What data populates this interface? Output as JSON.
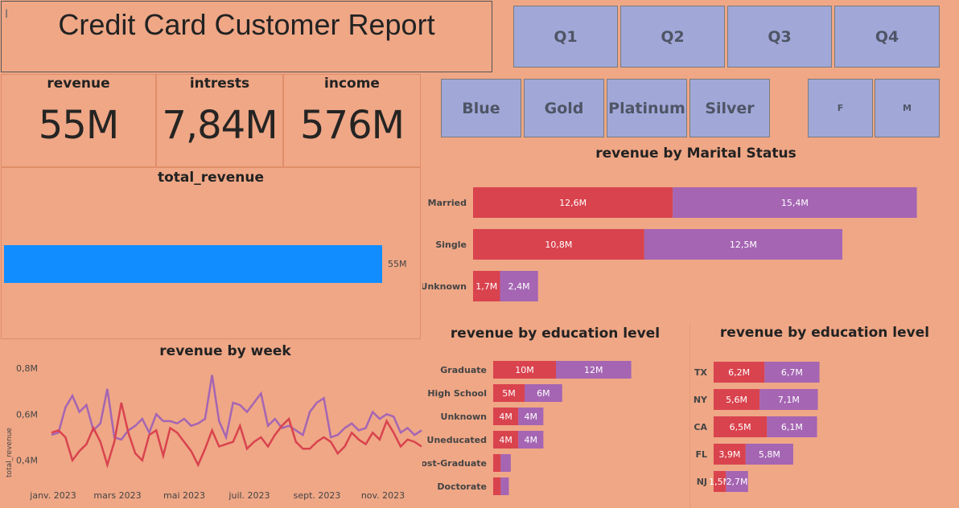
{
  "report": {
    "title": "Credit Card Customer Report",
    "cursor_glyph": "I"
  },
  "kpis": [
    {
      "label": "revenue",
      "value": "55M"
    },
    {
      "label": "intrests",
      "value": "7,84M"
    },
    {
      "label": "income",
      "value": "576M"
    }
  ],
  "quarter_slicer": [
    "Q1",
    "Q2",
    "Q3",
    "Q4"
  ],
  "card_slicer": [
    "Blue",
    "Gold",
    "Platinum",
    "Silver"
  ],
  "gender_slicer": [
    "F",
    "M"
  ],
  "colors": {
    "background": "#EFA786",
    "series_red": "#D9434E",
    "series_purple": "#A565B3",
    "total_bar": "#118DFF",
    "slicer": "#A1A8D8"
  },
  "chart_data": [
    {
      "type": "bar",
      "title": "total_revenue",
      "orientation": "horizontal",
      "values": [
        55
      ],
      "data_labels": [
        "55M"
      ],
      "unit": "M"
    },
    {
      "type": "line",
      "title": "revenue by week",
      "ylabel": "total_revenue",
      "ylim": [
        0.35,
        0.8
      ],
      "yticks": [
        "0,8M",
        "0,6M",
        "0,4M"
      ],
      "ytick_values": [
        0.8,
        0.6,
        0.4
      ],
      "xticks": [
        "janv. 2023",
        "mars 2023",
        "mai 2023",
        "juil. 2023",
        "sept. 2023",
        "nov. 2023"
      ],
      "series": [
        {
          "color": "#A565B3",
          "values": [
            0.51,
            0.52,
            0.63,
            0.68,
            0.61,
            0.64,
            0.53,
            0.56,
            0.71,
            0.5,
            0.49,
            0.53,
            0.55,
            0.58,
            0.52,
            0.6,
            0.57,
            0.57,
            0.56,
            0.58,
            0.55,
            0.56,
            0.58,
            0.77,
            0.57,
            0.5,
            0.65,
            0.64,
            0.61,
            0.65,
            0.69,
            0.55,
            0.58,
            0.54,
            0.55,
            0.53,
            0.51,
            0.61,
            0.65,
            0.67,
            0.5,
            0.51,
            0.54,
            0.56,
            0.53,
            0.54,
            0.61,
            0.58,
            0.6,
            0.59,
            0.52,
            0.54,
            0.51,
            0.53
          ]
        },
        {
          "color": "#D9434E",
          "values": [
            0.52,
            0.53,
            0.5,
            0.4,
            0.44,
            0.47,
            0.54,
            0.48,
            0.38,
            0.48,
            0.65,
            0.52,
            0.43,
            0.4,
            0.51,
            0.53,
            0.42,
            0.54,
            0.52,
            0.48,
            0.44,
            0.38,
            0.45,
            0.53,
            0.46,
            0.47,
            0.48,
            0.55,
            0.45,
            0.48,
            0.5,
            0.46,
            0.51,
            0.55,
            0.58,
            0.48,
            0.45,
            0.45,
            0.48,
            0.5,
            0.48,
            0.43,
            0.46,
            0.52,
            0.49,
            0.47,
            0.52,
            0.49,
            0.57,
            0.52,
            0.46,
            0.49,
            0.48,
            0.46
          ]
        }
      ]
    },
    {
      "type": "bar",
      "stacked": true,
      "orientation": "horizontal",
      "title": "revenue by Marital Status",
      "categories": [
        "Married",
        "Single",
        "Unknown"
      ],
      "series": [
        {
          "color": "#D9434E",
          "values": [
            12.6,
            10.8,
            1.7
          ],
          "labels": [
            "12,6M",
            "10,8M",
            "1,7M"
          ]
        },
        {
          "color": "#A565B3",
          "values": [
            15.4,
            12.5,
            2.4
          ],
          "labels": [
            "15,4M",
            "12,5M",
            "2,4M"
          ]
        }
      ]
    },
    {
      "type": "bar",
      "stacked": true,
      "orientation": "horizontal",
      "title": "revenue by education level",
      "categories": [
        "Graduate",
        "High School",
        "Unknown",
        "Uneducated",
        "Post-Graduate",
        "Doctorate"
      ],
      "series": [
        {
          "color": "#D9434E",
          "values": [
            10,
            5,
            4,
            4,
            1.2,
            1.2
          ],
          "labels": [
            "10M",
            "5M",
            "4M",
            "4M",
            "",
            ""
          ]
        },
        {
          "color": "#A565B3",
          "values": [
            12,
            6,
            4,
            4,
            1.6,
            1.3
          ],
          "labels": [
            "12M",
            "6M",
            "4M",
            "4M",
            "",
            ""
          ]
        }
      ]
    },
    {
      "type": "bar",
      "stacked": true,
      "orientation": "horizontal",
      "title": "revenue by education level",
      "categories": [
        "TX",
        "NY",
        "CA",
        "FL",
        "NJ"
      ],
      "series": [
        {
          "color": "#D9434E",
          "values": [
            6.2,
            5.6,
            6.5,
            3.9,
            1.5
          ],
          "labels": [
            "6,2M",
            "5,6M",
            "6,5M",
            "3,9M",
            "1,5M"
          ]
        },
        {
          "color": "#A565B3",
          "values": [
            6.7,
            7.1,
            6.1,
            5.8,
            2.7
          ],
          "labels": [
            "6,7M",
            "7,1M",
            "6,1M",
            "5,8M",
            "2,7M"
          ]
        }
      ]
    }
  ]
}
